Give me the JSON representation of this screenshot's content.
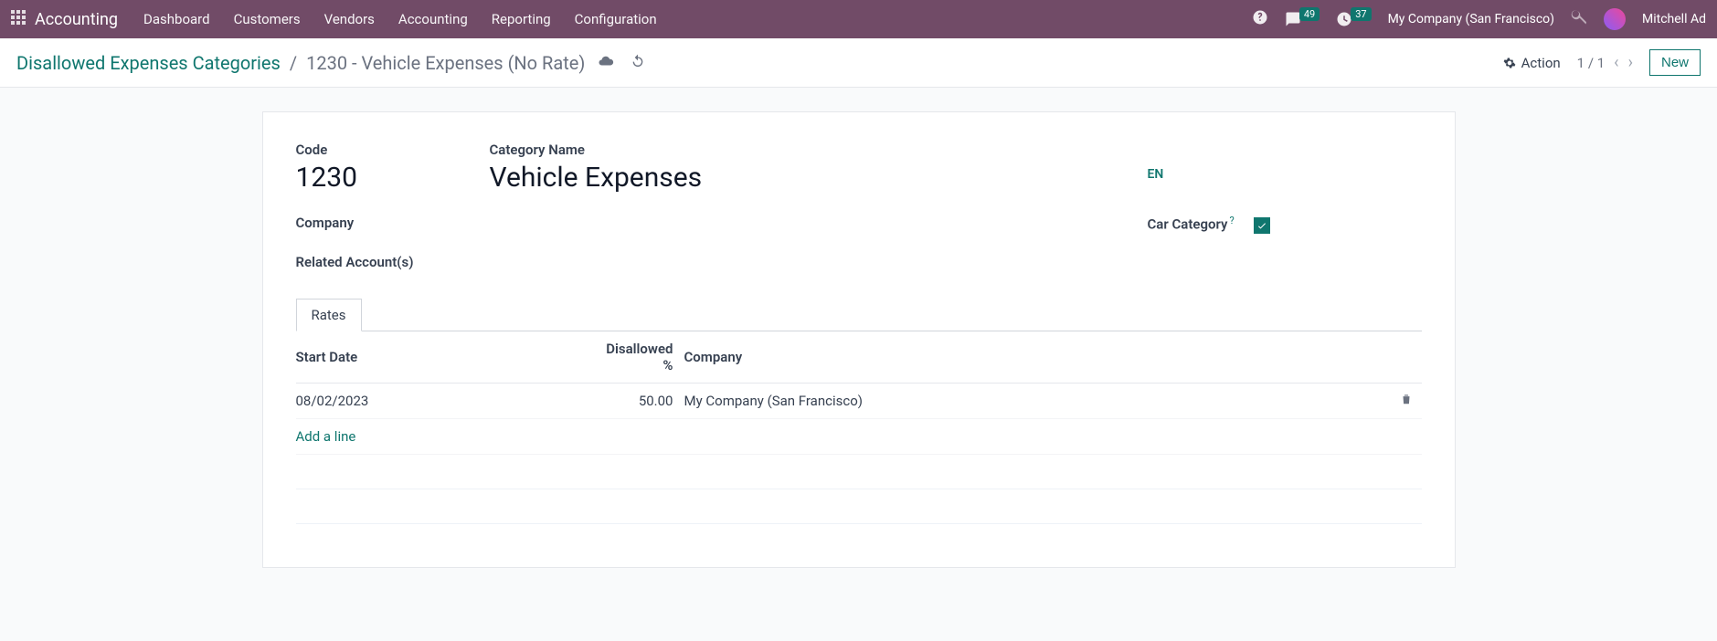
{
  "topbar": {
    "brand": "Accounting",
    "menu": [
      "Dashboard",
      "Customers",
      "Vendors",
      "Accounting",
      "Reporting",
      "Configuration"
    ],
    "messages_badge": "49",
    "activities_badge": "37",
    "company": "My Company (San Francisco)",
    "user": "Mitchell Ad"
  },
  "controlbar": {
    "breadcrumb_root": "Disallowed Expenses Categories",
    "breadcrumb_sep": "/",
    "breadcrumb_current": "1230 - Vehicle Expenses (No Rate)",
    "action_label": "Action",
    "pager": "1 / 1",
    "new_label": "New"
  },
  "form": {
    "code_label": "Code",
    "code_value": "1230",
    "category_label": "Category Name",
    "category_value": "Vehicle Expenses",
    "lang": "EN",
    "company_label": "Company",
    "car_category_label": "Car Category",
    "related_accounts_label": "Related Account(s)"
  },
  "tabs": {
    "rates": "Rates"
  },
  "table": {
    "headers": {
      "start": "Start Date",
      "pct": "Disallowed %",
      "company": "Company"
    },
    "rows": [
      {
        "start": "08/02/2023",
        "pct": "50.00",
        "company": "My Company (San Francisco)"
      }
    ],
    "add_line": "Add a line"
  }
}
